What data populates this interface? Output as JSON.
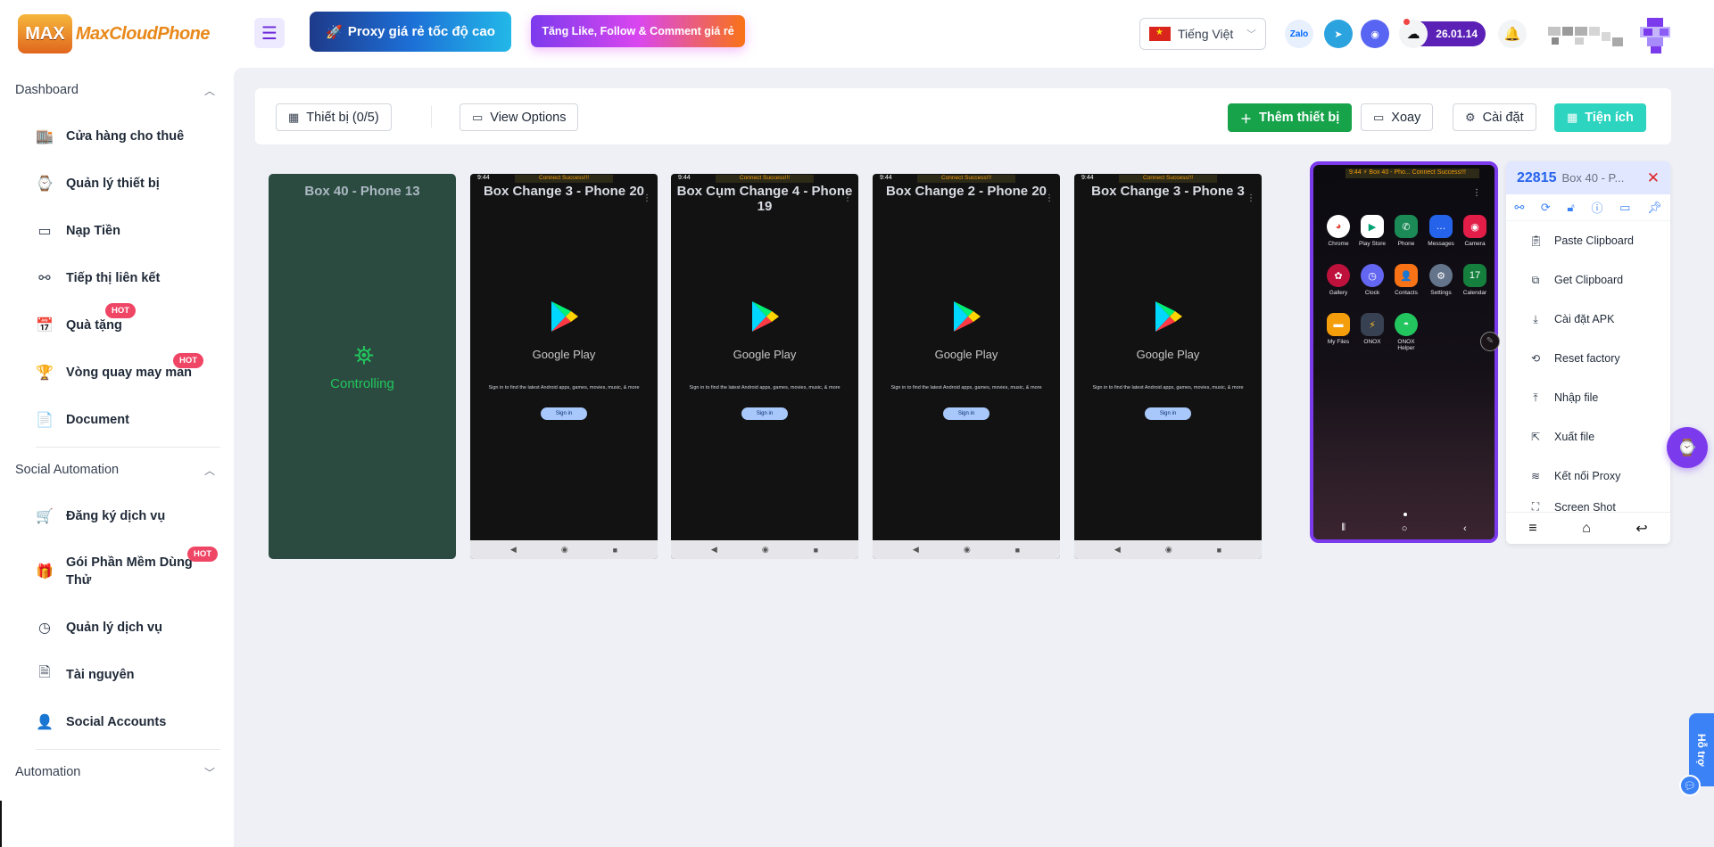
{
  "header": {
    "logo_mark": "MAX",
    "logo_word": "MaxCloudPhone",
    "promo_proxy": "Proxy giá rẻ tốc độ cao",
    "promo_like": "Tăng Like, Follow & Comment giá rẻ",
    "language": "Tiếng Việt",
    "zalo": "Zalo",
    "version": "26.01.14"
  },
  "sidebar": {
    "dashboard": "Dashboard",
    "dashboard_items": [
      "Cửa hàng cho thuê",
      "Quản lý thiết bị",
      "Nạp Tiền",
      "Tiếp thị liên kết",
      "Quà tặng",
      "Vòng quay may mắn",
      "Document"
    ],
    "social": "Social Automation",
    "social_items": [
      "Đăng ký dịch vụ",
      "Gói Phần Mềm Dùng Thử",
      "Quản lý dịch vụ",
      "Tài nguyên",
      "Social Accounts"
    ],
    "automation": "Automation",
    "hot": "HOT"
  },
  "toolbar": {
    "devices": "Thiết bị (0/5)",
    "view_options": "View Options",
    "add_device": "Thêm thiết bị",
    "rotate": "Xoay",
    "settings": "Cài đặt",
    "utilities": "Tiện ích"
  },
  "cards": [
    {
      "title": "Box 40 - Phone 13",
      "state": "Controlling"
    },
    {
      "title": "Box Change 3 - Phone 20"
    },
    {
      "title": "Box Cụm Change 4 - Phone 19"
    },
    {
      "title": "Box Change 2 - Phone 20"
    },
    {
      "title": "Box Change 3 - Phone 3"
    }
  ],
  "phone_screen": {
    "time": "9:44",
    "connect": "Connect Success!!!",
    "store": "Google Play",
    "subtitle": "Sign in to find the latest Android apps, games, movies, music, & more",
    "sign_in": "Sign in"
  },
  "live_device": {
    "status": "9:44 ⚡ Box 40 - Pho... Connect Success!!!",
    "apps": [
      "Chrome",
      "Play Store",
      "Phone",
      "Messages",
      "Camera",
      "Gallery",
      "Clock",
      "Contacts",
      "Settings",
      "Calendar",
      "My Files",
      "ONOX",
      "ONOX Helper"
    ]
  },
  "panel": {
    "id": "22815",
    "name": "Box 40 - P...",
    "items": [
      "Paste Clipboard",
      "Get Clipboard",
      "Cài đặt APK",
      "Reset factory",
      "Nhập file",
      "Xuất file",
      "Kết nối Proxy",
      "Screen Shot"
    ]
  },
  "support": "Hỗ trợ",
  "colors": {
    "accent": "#7c3aed",
    "success": "#16a34a",
    "teal": "#2dd4bf",
    "hot": "#ef4665",
    "controlling_bg": "#2c4b40"
  }
}
